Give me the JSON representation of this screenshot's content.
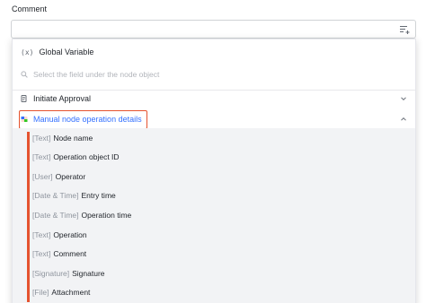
{
  "comment": {
    "label": "Comment",
    "value": "",
    "insert_icon": "insert-variable-icon"
  },
  "dropdown": {
    "global_variable": {
      "icon_text": "(x)",
      "label": "Global Variable"
    },
    "search": {
      "placeholder": "Select the field under the node object"
    },
    "groups": [
      {
        "label": "Initiate Approval",
        "expanded": false
      },
      {
        "label": "Manual node operation details",
        "expanded": true
      }
    ],
    "fields": [
      {
        "type": "[Text]",
        "name": "Node name"
      },
      {
        "type": "[Text]",
        "name": "Operation object ID"
      },
      {
        "type": "[User]",
        "name": "Operator"
      },
      {
        "type": "[Date & Time]",
        "name": "Entry time"
      },
      {
        "type": "[Date & Time]",
        "name": "Operation time"
      },
      {
        "type": "[Text]",
        "name": "Operation"
      },
      {
        "type": "[Text]",
        "name": "Comment"
      },
      {
        "type": "[Signature]",
        "name": "Signature"
      },
      {
        "type": "[File]",
        "name": "Attachment"
      }
    ]
  },
  "colors": {
    "accent": "#3370ff",
    "highlight": "#e5532f",
    "panel_bg": "#f2f3f5"
  }
}
